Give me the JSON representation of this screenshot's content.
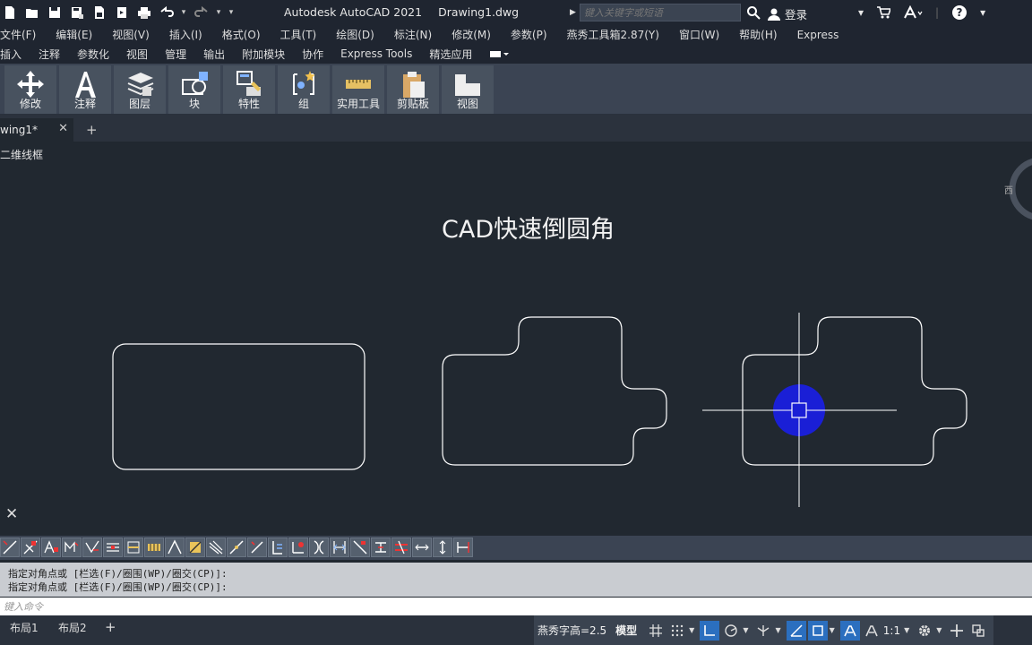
{
  "title_bar": {
    "app_name": "Autodesk AutoCAD 2021",
    "file_name": "Drawing1.dwg",
    "search_placeholder": "键入关键字或短语",
    "login_label": "登录",
    "quick_access_icons": [
      "new-icon",
      "open-icon",
      "save-icon",
      "saveas-icon",
      "plot-icon",
      "publish-icon",
      "print-icon",
      "undo-icon",
      "redo-icon",
      "qat-menu-icon"
    ]
  },
  "menu_bar": {
    "items": [
      "文件(F)",
      "编辑(E)",
      "视图(V)",
      "插入(I)",
      "格式(O)",
      "工具(T)",
      "绘图(D)",
      "标注(N)",
      "修改(M)",
      "参数(P)",
      "燕秀工具箱2.87(Y)",
      "窗口(W)",
      "帮助(H)",
      "Express"
    ]
  },
  "ribbon_tabs": {
    "items": [
      "插入",
      "注释",
      "参数化",
      "视图",
      "管理",
      "输出",
      "附加模块",
      "协作",
      "Express Tools",
      "精选应用"
    ]
  },
  "ribbon": {
    "buttons": [
      {
        "label": "修改",
        "icon": "move-icon"
      },
      {
        "label": "注释",
        "icon": "text-icon"
      },
      {
        "label": "图层",
        "icon": "layers-icon"
      },
      {
        "label": "块",
        "icon": "block-icon"
      },
      {
        "label": "特性",
        "icon": "properties-icon"
      },
      {
        "label": "组",
        "icon": "group-icon"
      },
      {
        "label": "实用工具",
        "icon": "measure-icon"
      },
      {
        "label": "剪贴板",
        "icon": "clipboard-icon"
      },
      {
        "label": "视图",
        "icon": "view-icon"
      }
    ]
  },
  "doc_tabs": {
    "active_tab": "wing1*",
    "close_label": "✕",
    "new_tab_label": "+"
  },
  "canvas": {
    "view_label": "二维线框",
    "drawing_title": "CAD快速倒圆角",
    "viewcube_label": "西",
    "colors": {
      "background": "#212830",
      "lines": "#ffffff",
      "highlight": "#1a1fd6"
    }
  },
  "command": {
    "history": [
      "指定对角点或 [栏选(F)/圈围(WP)/圈交(CP)]:",
      "指定对角点或 [栏选(F)/圈围(WP)/圈交(CP)]:"
    ],
    "input_placeholder": "键入命令"
  },
  "status_bar": {
    "layout_tabs": [
      "布局1",
      "布局2"
    ],
    "add_layout": "+",
    "text_height": "燕秀字高=2.5",
    "model_label": "模型",
    "scale": "1:1"
  }
}
